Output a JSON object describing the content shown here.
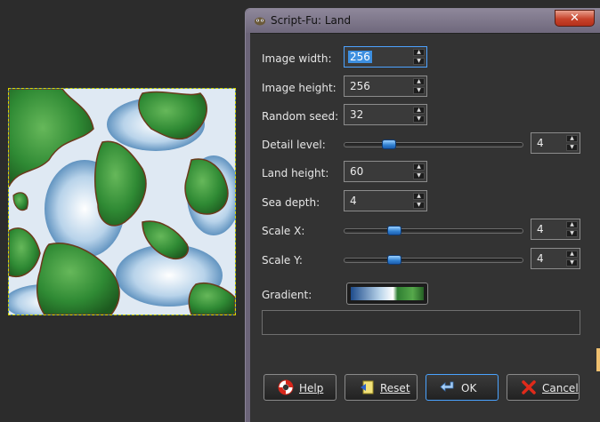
{
  "window": {
    "title": "Script-Fu: Land",
    "close_glyph": "✕"
  },
  "fields": {
    "image_width": {
      "label": "Image width:",
      "value": "256"
    },
    "image_height": {
      "label": "Image height:",
      "value": "256"
    },
    "random_seed": {
      "label": "Random seed:",
      "value": "32"
    },
    "detail_level": {
      "label": "Detail level:",
      "value": "4",
      "slider_fraction": 0.23
    },
    "land_height": {
      "label": "Land height:",
      "value": "60"
    },
    "sea_depth": {
      "label": "Sea depth:",
      "value": "4"
    },
    "scale_x": {
      "label": "Scale X:",
      "value": "4",
      "slider_fraction": 0.26
    },
    "scale_y": {
      "label": "Scale Y:",
      "value": "4",
      "slider_fraction": 0.26
    },
    "gradient": {
      "label": "Gradient:"
    }
  },
  "buttons": {
    "help": "Help",
    "reset": "Reset",
    "ok": "OK",
    "cancel": "Cancel"
  },
  "icons": {
    "app": "gimp-icon",
    "help": "lifebuoy-icon",
    "reset": "reset-icon",
    "ok": "return-arrow-icon",
    "cancel": "red-x-icon"
  }
}
